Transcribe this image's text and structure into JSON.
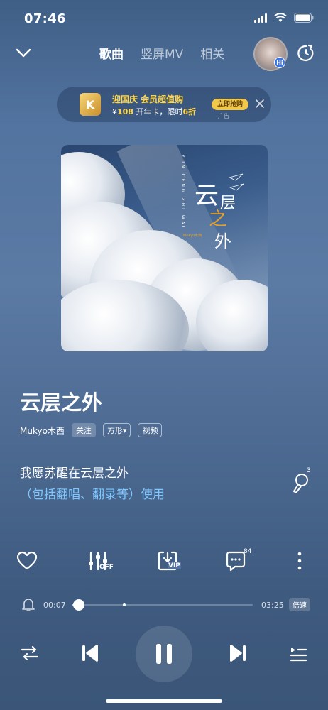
{
  "status_bar": {
    "time": "07:46"
  },
  "header": {
    "tabs": [
      {
        "label": "歌曲",
        "active": true
      },
      {
        "label": "竖屏MV",
        "active": false
      },
      {
        "label": "相关",
        "active": false
      }
    ],
    "avatar_badge": "Hi"
  },
  "ad": {
    "logo_letter": "K",
    "title": "迎国庆 会员超值购",
    "subtitle_prefix": "¥",
    "price": "108",
    "subtitle_mid": " 开年卡，限时",
    "discount": "6折",
    "cta": "立即抢购",
    "tag": "广告"
  },
  "cover": {
    "pinyin": "YUN CENG ZHI WAI",
    "title_chars": [
      "云",
      "层",
      "之",
      "外"
    ],
    "artist_small": "Mukyo木西"
  },
  "song": {
    "title": "云层之外",
    "artist": "Mukyo木西",
    "follow_label": "关注",
    "mode_label": "方形▾",
    "video_label": "视频"
  },
  "lyrics": {
    "line1": "我愿苏醒在云层之外",
    "line2": "（包括翻唱、翻录等）使用"
  },
  "actions": {
    "sing_count": "3",
    "effect_sub": "OFF",
    "download_sub": "VIP",
    "comment_count": "84"
  },
  "progress": {
    "current": "00:07",
    "total": "03:25",
    "fraction": 0.034,
    "speed_label": "倍速"
  },
  "colors": {
    "accent_lyric": "#7fc8ff",
    "ad_gold": "#ffd64a"
  }
}
